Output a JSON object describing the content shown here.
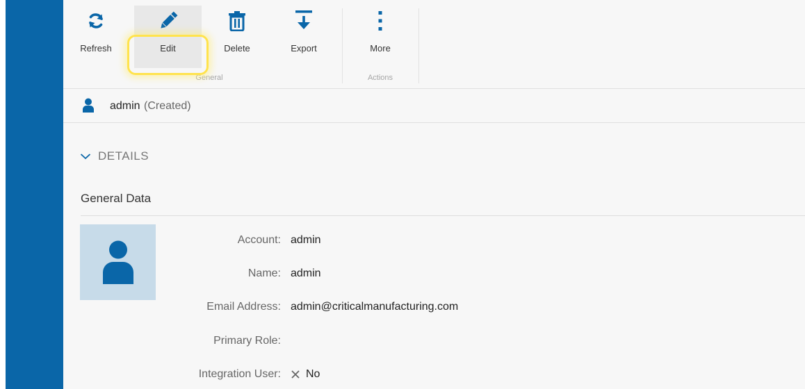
{
  "ribbon": {
    "groups": [
      {
        "label": "General"
      },
      {
        "label": "Actions"
      }
    ],
    "buttons": {
      "refresh": "Refresh",
      "edit": "Edit",
      "delete": "Delete",
      "export": "Export",
      "more": "More"
    }
  },
  "entity": {
    "name": "admin",
    "state": "(Created)"
  },
  "details": {
    "toggle_label": "DETAILS",
    "section_title": "General Data",
    "fields": [
      {
        "label": "Account:",
        "value": "admin"
      },
      {
        "label": "Name:",
        "value": "admin"
      },
      {
        "label": "Email Address:",
        "value": "admin@criticalmanufacturing.com"
      },
      {
        "label": "Primary Role:",
        "value": ""
      },
      {
        "label": "Integration User:",
        "value": "No"
      }
    ]
  },
  "colors": {
    "accent": "#0a66a8",
    "avatar_bg": "#c7dbe9",
    "highlight": "#ffe34d"
  },
  "icons": {
    "refresh": "refresh-icon",
    "edit": "pencil-icon",
    "delete": "trash-icon",
    "export": "export-icon",
    "more": "vertical-dots-icon",
    "user": "user-icon",
    "toggle": "chevron-down-icon",
    "no": "cross-icon"
  }
}
